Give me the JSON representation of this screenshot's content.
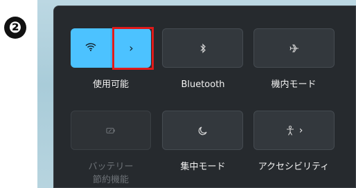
{
  "step_badge": "❷",
  "tiles": [
    {
      "label": "使用可能",
      "icon": "wifi-icon",
      "arrow": "›",
      "active": true
    },
    {
      "label": "Bluetooth",
      "icon": "bluetooth-icon",
      "active": false
    },
    {
      "label": "機内モード",
      "icon": "airplane-icon",
      "active": false
    },
    {
      "label_line1": "バッテリー",
      "label_line2": "節約機能",
      "icon": "battery-saver-icon",
      "active": false,
      "disabled": true
    },
    {
      "label": "集中モード",
      "icon": "focus-moon-icon",
      "active": false
    },
    {
      "label": "アクセシビリティ",
      "icon": "accessibility-icon",
      "arrow": "›",
      "active": false
    }
  ],
  "colors": {
    "accent": "#4cc2ff",
    "highlight": "#e01a1a",
    "panel": "#262a2e"
  }
}
